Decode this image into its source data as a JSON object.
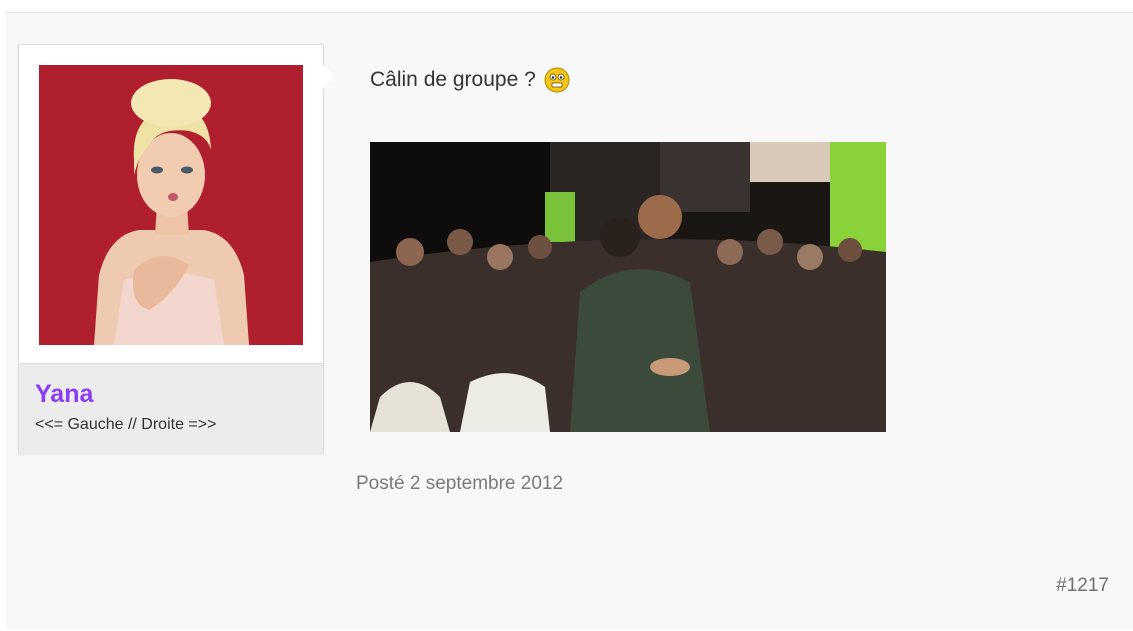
{
  "post": {
    "text": "Câlin de groupe ?",
    "emoji": "embarrassed-smiley",
    "date": "Posté 2 septembre 2012",
    "number": "#1217",
    "image": "group-hug-photo"
  },
  "author": {
    "name": "Yana",
    "title": "<<= Gauche // Droite =>>",
    "avatar": "blonde-woman-avatar"
  },
  "colors": {
    "username": "#8a3df5",
    "avatar_bg": "#b01f2e",
    "frame_bg": "#f8f8f8"
  }
}
